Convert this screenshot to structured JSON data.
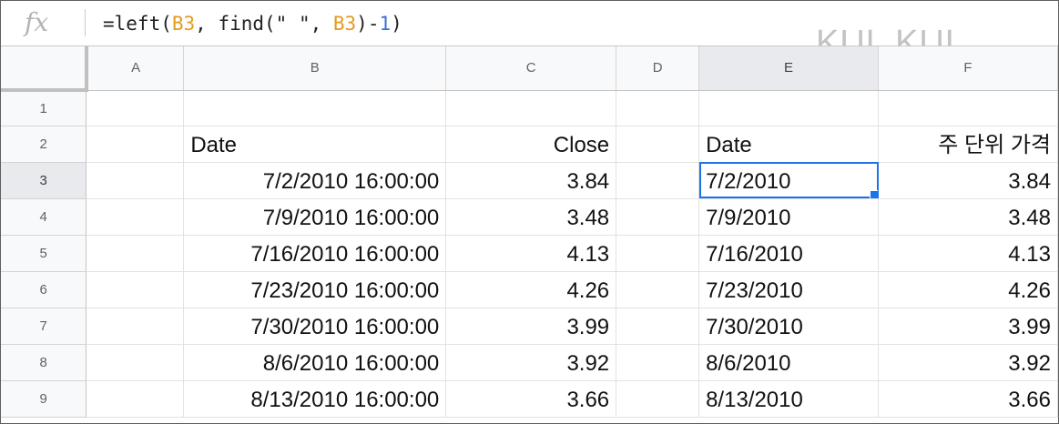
{
  "formula_bar": {
    "fx_label": "fx",
    "formula_parts": [
      {
        "text": "=left(",
        "kind": "plain"
      },
      {
        "text": "B3",
        "kind": "ref"
      },
      {
        "text": ", find(\" \", ",
        "kind": "plain"
      },
      {
        "text": "B3",
        "kind": "ref"
      },
      {
        "text": ")-",
        "kind": "plain"
      },
      {
        "text": "1",
        "kind": "num"
      },
      {
        "text": ")",
        "kind": "plain"
      }
    ]
  },
  "watermark": "KUL KUL",
  "columns": [
    "A",
    "B",
    "C",
    "D",
    "E",
    "F"
  ],
  "active_column": "E",
  "active_row": "3",
  "rows": [
    {
      "num": "1",
      "A": "",
      "B": "",
      "C": "",
      "D": "",
      "E": "",
      "F": ""
    },
    {
      "num": "2",
      "A": "",
      "B": "Date",
      "C": "Close",
      "D": "",
      "E": "Date",
      "F": "주 단위 가격"
    },
    {
      "num": "3",
      "A": "",
      "B": "7/2/2010 16:00:00",
      "C": "3.84",
      "D": "",
      "E": "7/2/2010",
      "F": "3.84"
    },
    {
      "num": "4",
      "A": "",
      "B": "7/9/2010 16:00:00",
      "C": "3.48",
      "D": "",
      "E": "7/9/2010",
      "F": "3.48"
    },
    {
      "num": "5",
      "A": "",
      "B": "7/16/2010 16:00:00",
      "C": "4.13",
      "D": "",
      "E": "7/16/2010",
      "F": "4.13"
    },
    {
      "num": "6",
      "A": "",
      "B": "7/23/2010 16:00:00",
      "C": "4.26",
      "D": "",
      "E": "7/23/2010",
      "F": "4.26"
    },
    {
      "num": "7",
      "A": "",
      "B": "7/30/2010 16:00:00",
      "C": "3.99",
      "D": "",
      "E": "7/30/2010",
      "F": "3.99"
    },
    {
      "num": "8",
      "A": "",
      "B": "8/6/2010 16:00:00",
      "C": "3.92",
      "D": "",
      "E": "8/6/2010",
      "F": "3.92"
    },
    {
      "num": "9",
      "A": "",
      "B": "8/13/2010 16:00:00",
      "C": "3.66",
      "D": "",
      "E": "8/13/2010",
      "F": "3.66"
    }
  ],
  "colors": {
    "selection": "#1a73e8",
    "ref_token": "#e69a1e",
    "number_token": "#3b6fd8",
    "header_bg": "#f8f9fa",
    "grid_line": "#e2e2e2"
  }
}
